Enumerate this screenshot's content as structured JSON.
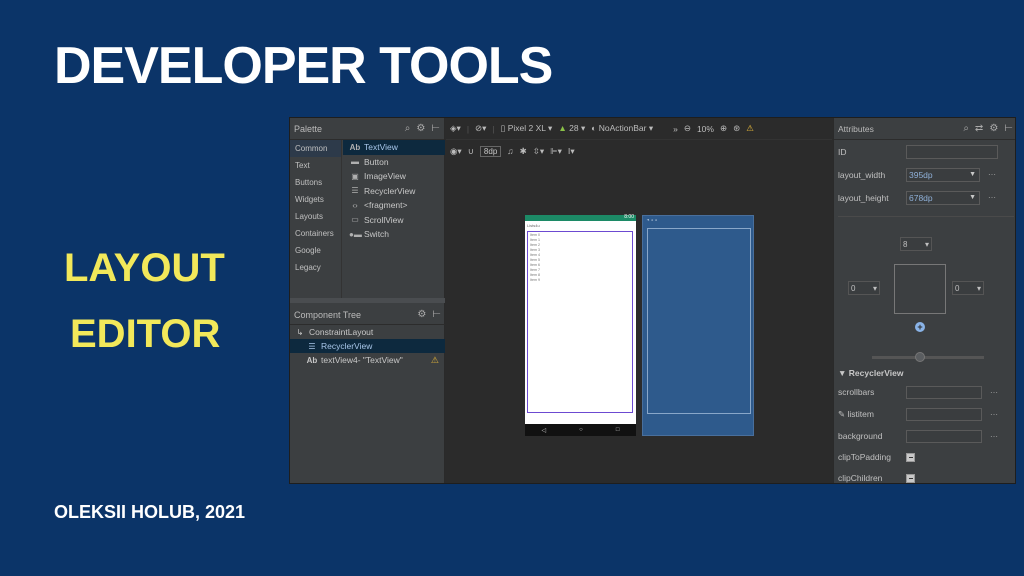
{
  "slide": {
    "title": "DEVELOPER TOOLS",
    "subtitle_line1": "LAYOUT",
    "subtitle_line2": "EDITOR",
    "author": "OLEKSII HOLUB, 2021"
  },
  "palette": {
    "title": "Palette",
    "categories": [
      "Common",
      "Text",
      "Buttons",
      "Widgets",
      "Layouts",
      "Containers",
      "Google",
      "Legacy"
    ],
    "items": [
      "TextView",
      "Button",
      "ImageView",
      "RecyclerView",
      "<fragment>",
      "ScrollView",
      "Switch"
    ]
  },
  "component_tree": {
    "title": "Component Tree",
    "rows": [
      "ConstraintLayout",
      "RecyclerView",
      "textView4- \"TextView\""
    ]
  },
  "toolbar": {
    "device": "Pixel 2 XL",
    "api": "28",
    "theme": "NoActionBar",
    "zoom": "10%",
    "margin": "8dp"
  },
  "preview": {
    "status_time": "8:00",
    "app_title": "Lists4u",
    "list_items": [
      "Item 0",
      "Item 1",
      "Item 2",
      "Item 3",
      "Item 4",
      "Item 5",
      "Item 6",
      "Item 7",
      "Item 8",
      "Item 9"
    ]
  },
  "attributes": {
    "title": "Attributes",
    "id_label": "ID",
    "id_value": "",
    "layout_width_label": "layout_width",
    "layout_width_value": "395dp",
    "layout_height_label": "layout_height",
    "layout_height_value": "678dp",
    "constraint_top": "8",
    "constraint_left": "0",
    "constraint_right": "0",
    "section_title": "RecyclerView",
    "scrollbars_label": "scrollbars",
    "listitem_label": "listitem",
    "background_label": "background",
    "clipToPadding_label": "clipToPadding",
    "clipChildren_label": "clipChildren"
  }
}
